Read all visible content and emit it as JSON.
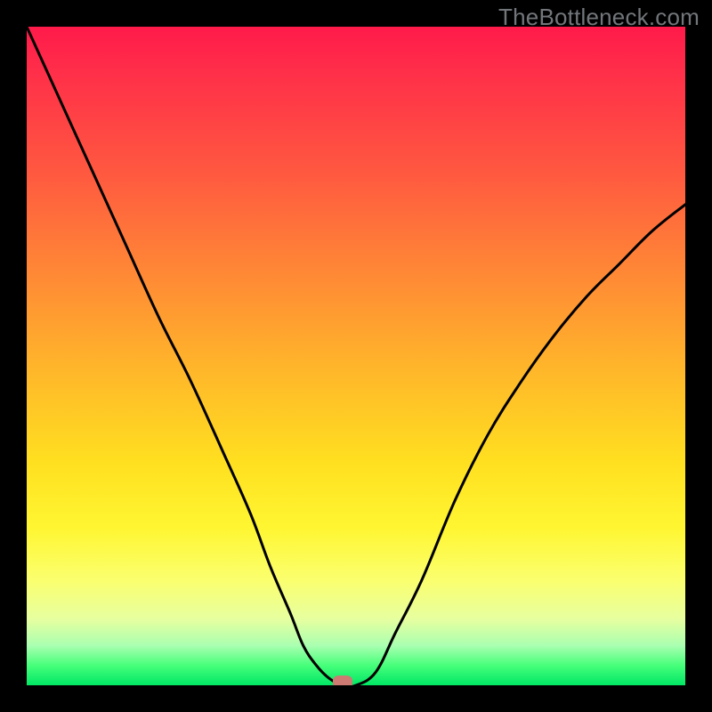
{
  "watermark": "TheBottleneck.com",
  "chart_data": {
    "type": "line",
    "title": "",
    "xlabel": "",
    "ylabel": "",
    "xlim": [
      0,
      100
    ],
    "ylim": [
      0,
      100
    ],
    "grid": false,
    "series": [
      {
        "name": "curve",
        "x": [
          0,
          5,
          10,
          15,
          20,
          25,
          30,
          34,
          37,
          40,
          42,
          44,
          46,
          48,
          50,
          53,
          56,
          60,
          65,
          70,
          75,
          80,
          85,
          90,
          95,
          100
        ],
        "y": [
          100,
          89,
          78,
          67,
          56,
          46,
          35,
          26,
          18,
          11,
          6,
          3,
          1,
          0,
          0,
          2,
          8,
          16,
          28,
          38,
          46,
          53,
          59,
          64,
          69,
          73
        ]
      }
    ],
    "marker": {
      "x": 48,
      "y": 0.5,
      "color": "#cc7a72"
    },
    "background_gradient": {
      "top": "#ff1a4a",
      "mid_upper": "#ff8a35",
      "mid": "#ffdf20",
      "mid_lower": "#fbff6e",
      "bottom": "#00e765"
    }
  }
}
